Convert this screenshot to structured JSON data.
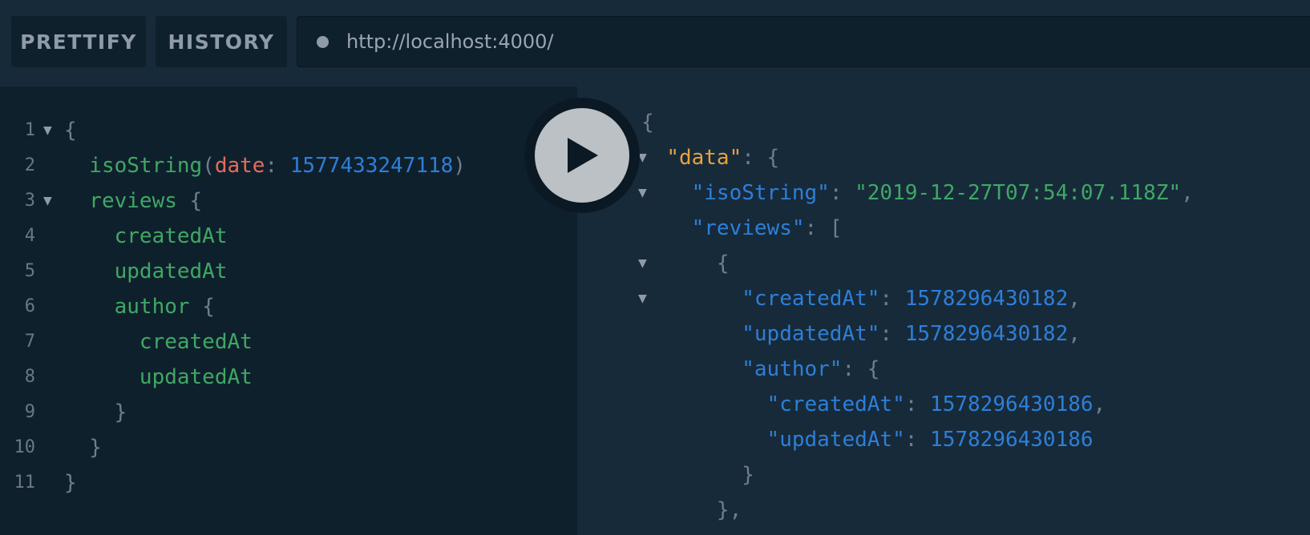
{
  "toolbar": {
    "prettify_label": "PRETTIFY",
    "history_label": "HISTORY",
    "url_value": "http://localhost:4000/"
  },
  "editor": {
    "line_numbers": [
      "1",
      "2",
      "3",
      "4",
      "5",
      "6",
      "7",
      "8",
      "9",
      "10",
      "11"
    ],
    "lines": [
      [
        {
          "t": "{",
          "c": "punc"
        }
      ],
      [
        {
          "t": "  isoString",
          "c": "field"
        },
        {
          "t": "(",
          "c": "punc"
        },
        {
          "t": "date",
          "c": "arg"
        },
        {
          "t": ": ",
          "c": "punc"
        },
        {
          "t": "1577433247118",
          "c": "num"
        },
        {
          "t": ")",
          "c": "punc"
        }
      ],
      [
        {
          "t": "  reviews",
          "c": "field"
        },
        {
          "t": " {",
          "c": "punc"
        }
      ],
      [
        {
          "t": "    createdAt",
          "c": "field"
        }
      ],
      [
        {
          "t": "    updatedAt",
          "c": "field"
        }
      ],
      [
        {
          "t": "    author",
          "c": "field"
        },
        {
          "t": " {",
          "c": "punc"
        }
      ],
      [
        {
          "t": "      createdAt",
          "c": "field"
        }
      ],
      [
        {
          "t": "      updatedAt",
          "c": "field"
        }
      ],
      [
        {
          "t": "    }",
          "c": "punc"
        }
      ],
      [
        {
          "t": "  }",
          "c": "punc"
        }
      ],
      [
        {
          "t": "}",
          "c": "punc"
        }
      ]
    ],
    "folds": [
      1,
      3
    ]
  },
  "result": {
    "lines": [
      [
        {
          "t": "{",
          "c": "punc"
        }
      ],
      [
        {
          "t": "  ",
          "c": "punc"
        },
        {
          "t": "\"data\"",
          "c": "key-data"
        },
        {
          "t": ": {",
          "c": "punc"
        }
      ],
      [
        {
          "t": "    ",
          "c": "punc"
        },
        {
          "t": "\"isoString\"",
          "c": "key"
        },
        {
          "t": ": ",
          "c": "punc"
        },
        {
          "t": "\"2019-12-27T07:54:07.118Z\"",
          "c": "str"
        },
        {
          "t": ",",
          "c": "punc"
        }
      ],
      [
        {
          "t": "    ",
          "c": "punc"
        },
        {
          "t": "\"reviews\"",
          "c": "key"
        },
        {
          "t": ": [",
          "c": "punc"
        }
      ],
      [
        {
          "t": "      {",
          "c": "punc"
        }
      ],
      [
        {
          "t": "        ",
          "c": "punc"
        },
        {
          "t": "\"createdAt\"",
          "c": "key"
        },
        {
          "t": ": ",
          "c": "punc"
        },
        {
          "t": "1578296430182",
          "c": "num"
        },
        {
          "t": ",",
          "c": "punc"
        }
      ],
      [
        {
          "t": "        ",
          "c": "punc"
        },
        {
          "t": "\"updatedAt\"",
          "c": "key"
        },
        {
          "t": ": ",
          "c": "punc"
        },
        {
          "t": "1578296430182",
          "c": "num"
        },
        {
          "t": ",",
          "c": "punc"
        }
      ],
      [
        {
          "t": "        ",
          "c": "punc"
        },
        {
          "t": "\"author\"",
          "c": "key"
        },
        {
          "t": ": {",
          "c": "punc"
        }
      ],
      [
        {
          "t": "          ",
          "c": "punc"
        },
        {
          "t": "\"createdAt\"",
          "c": "key"
        },
        {
          "t": ": ",
          "c": "punc"
        },
        {
          "t": "1578296430186",
          "c": "num"
        },
        {
          "t": ",",
          "c": "punc"
        }
      ],
      [
        {
          "t": "          ",
          "c": "punc"
        },
        {
          "t": "\"updatedAt\"",
          "c": "key"
        },
        {
          "t": ": ",
          "c": "punc"
        },
        {
          "t": "1578296430186",
          "c": "num"
        }
      ],
      [
        {
          "t": "        }",
          "c": "punc"
        }
      ],
      [
        {
          "t": "      },",
          "c": "punc"
        }
      ]
    ],
    "folds": [
      1,
      2,
      4,
      5
    ]
  },
  "icons": {
    "play": "play-icon",
    "fold": "fold-arrow-icon",
    "status": "status-dot-icon"
  },
  "colors": {
    "field": "#3fa864",
    "argument": "#e86a5a",
    "number": "#2d7fd8",
    "data_key": "#e8a23b",
    "punctuation": "#6f7e8c"
  }
}
